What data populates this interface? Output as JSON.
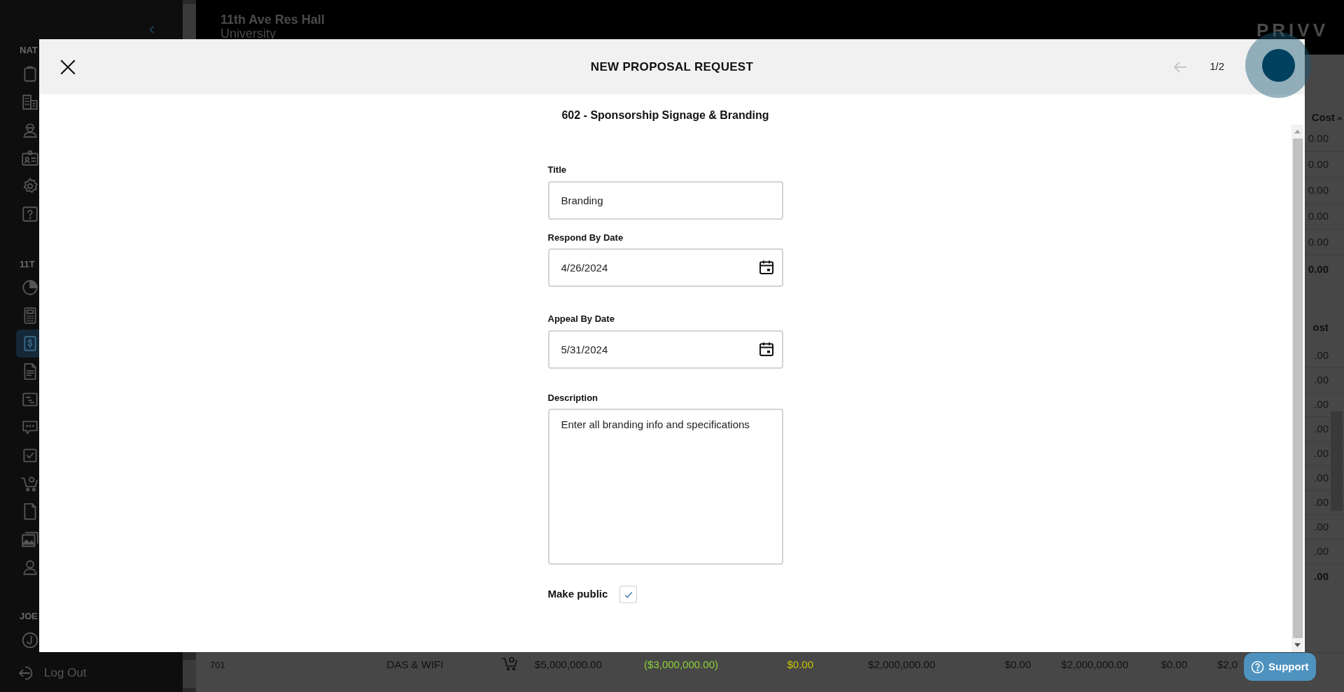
{
  "sidebar": {
    "sections": [
      {
        "label": "NAT",
        "items": [
          {
            "selected": false
          },
          {
            "selected": false
          },
          {
            "selected": false
          },
          {
            "selected": false
          },
          {
            "selected": false
          },
          {
            "selected": false
          }
        ]
      },
      {
        "label": "11T",
        "items": [
          {
            "selected": false
          },
          {
            "selected": false
          },
          {
            "selected": true
          },
          {
            "selected": false
          },
          {
            "selected": false
          },
          {
            "selected": false
          },
          {
            "selected": false
          },
          {
            "selected": false
          },
          {
            "selected": false
          },
          {
            "selected": false
          },
          {
            "selected": false
          }
        ]
      },
      {
        "label": "JOE",
        "items": [
          {
            "selected": false
          }
        ]
      }
    ],
    "logout": "Log Out"
  },
  "header": {
    "title": "11th Ave Res Hall",
    "subtitle": "University",
    "logo": "PRIVV"
  },
  "table_edge": {
    "header_1": "Cost",
    "rows_1": [
      "0.00",
      "0.00",
      "0.00",
      "0.00",
      "0.00"
    ],
    "total_1": "0.00",
    "header_2": "ost",
    "rows_2": [
      ".00",
      ".00",
      ".00",
      ".00",
      ".00",
      ".00",
      ".00",
      ".00",
      ".00"
    ],
    "total_2": ".00"
  },
  "table_row": {
    "cells": [
      {
        "text": "701"
      },
      {
        "text": "DAS & WIFI"
      },
      {
        "text": "$5,000,000.00"
      },
      {
        "text": "($3,000,000.00)",
        "color": "#8fd13a"
      },
      {
        "text": "$0.00",
        "color": "#c8c400"
      },
      {
        "text": "$2,000,000.00"
      },
      {
        "text": "$0.00"
      },
      {
        "text": "$2,000,000.00"
      },
      {
        "text": "$0.00"
      },
      {
        "text": "$2,0"
      }
    ]
  },
  "modal": {
    "title": "NEW PROPOSAL REQUEST",
    "pager": "1/2",
    "subtitle": "602 - Sponsorship Signage & Branding",
    "fields": [
      {
        "kind": "text",
        "label": "Title",
        "value": "Branding"
      },
      {
        "kind": "date",
        "label": "Respond By Date",
        "value": "4/26/2024"
      },
      {
        "kind": "date",
        "label": "Appeal By Date",
        "value": "5/31/2024"
      },
      {
        "kind": "textarea",
        "label": "Description",
        "value": "Enter all branding info and specifications"
      }
    ],
    "make_public": {
      "label": "Make public",
      "checked": true
    }
  },
  "support": {
    "label": "Support"
  }
}
